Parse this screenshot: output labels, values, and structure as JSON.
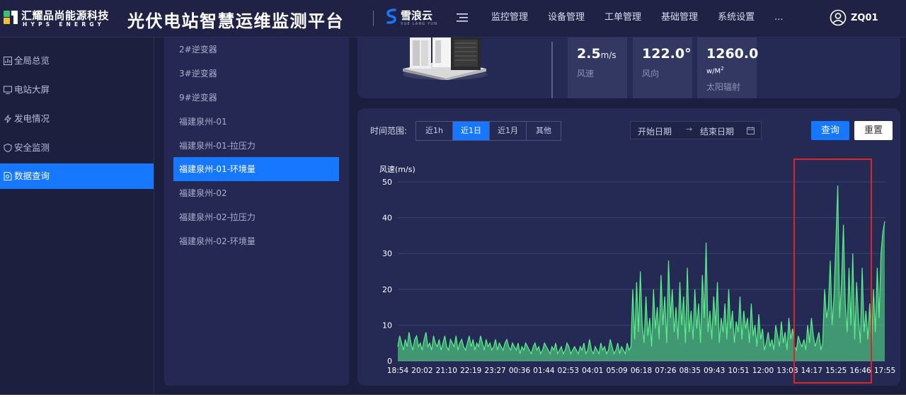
{
  "header": {
    "logo_text": "汇耀品尚能源科技",
    "logo_subtext": "HYPS ENERGY",
    "app_title": "光伏电站智慧运维监测平台",
    "brand_name": "雪浪云",
    "brand_subtext": "XUE LANG YUN",
    "nav": [
      "监控管理",
      "设备管理",
      "工单管理",
      "基础管理",
      "系统设置",
      "..."
    ],
    "user_name": "ZQ01"
  },
  "sidebar": {
    "items": [
      {
        "label": "全局总览",
        "icon": "dashboard-icon",
        "active": false
      },
      {
        "label": "电站大屏",
        "icon": "monitor-icon",
        "active": false
      },
      {
        "label": "发电情况",
        "icon": "lightning-icon",
        "active": false
      },
      {
        "label": "安全监测",
        "icon": "shield-icon",
        "active": false
      },
      {
        "label": "数据查询",
        "icon": "document-search-icon",
        "active": true
      }
    ]
  },
  "device_list": {
    "items": [
      {
        "label": "2#逆变器",
        "active": false
      },
      {
        "label": "3#逆变器",
        "active": false
      },
      {
        "label": "9#逆变器",
        "active": false
      },
      {
        "label": "福建泉州-01",
        "active": false
      },
      {
        "label": "福建泉州-01-拉压力",
        "active": false
      },
      {
        "label": "福建泉州-01-环境量",
        "active": true
      },
      {
        "label": "福建泉州-02",
        "active": false
      },
      {
        "label": "福建泉州-02-拉压力",
        "active": false
      },
      {
        "label": "福建泉州-02-环境量",
        "active": false
      }
    ]
  },
  "metrics": [
    {
      "value": "2.5",
      "unit": "m/s",
      "label": "风速"
    },
    {
      "value": "122.0°",
      "unit": "",
      "label": "风向"
    },
    {
      "value": "1260.0",
      "unit": "w/M",
      "unit_sup": "2",
      "label": "太阳辐射"
    }
  ],
  "filters": {
    "range_label": "时间范围:",
    "ranges": [
      {
        "label": "近1h",
        "active": false
      },
      {
        "label": "近1日",
        "active": true
      },
      {
        "label": "近1月",
        "active": false
      },
      {
        "label": "其他",
        "active": false
      }
    ],
    "start_placeholder": "开始日期",
    "end_placeholder": "结束日期",
    "query_label": "查询",
    "reset_label": "重置"
  },
  "colors": {
    "accent": "#1677ff",
    "series": "#59f08a",
    "highlight": "#e02424",
    "panel": "#252a55",
    "background": "#1b1e3c"
  },
  "chart_data": {
    "type": "line",
    "title": "",
    "xlabel": "",
    "ylabel": "风速(m/s)",
    "ylim": [
      0,
      50
    ],
    "yticks": [
      0,
      10,
      20,
      30,
      40,
      50
    ],
    "grid": true,
    "legend": "none",
    "x_tick_labels": [
      "18:54",
      "20:02",
      "21:10",
      "22:19",
      "23:27",
      "00:36",
      "01:44",
      "02:53",
      "04:01",
      "05:09",
      "06:18",
      "07:26",
      "08:35",
      "09:43",
      "10:51",
      "12:00",
      "13:08",
      "14:17",
      "15:25",
      "16:46",
      "17:55"
    ],
    "series": [
      {
        "values": [
          4,
          7,
          5,
          3,
          6,
          4,
          8,
          5,
          3,
          6,
          7,
          4,
          5,
          3,
          6,
          8,
          4,
          5,
          3,
          7,
          5,
          4,
          6,
          3,
          5,
          7,
          4,
          3,
          6,
          5,
          4,
          7,
          3,
          5,
          6,
          4,
          3,
          5,
          7,
          4,
          6,
          3,
          5,
          4,
          7,
          5,
          3,
          6,
          4,
          5,
          3,
          4,
          6,
          3,
          5,
          4,
          3,
          5,
          6,
          4,
          3,
          5,
          4,
          3,
          5,
          2,
          4,
          3,
          5,
          4,
          3,
          2,
          4,
          5,
          3,
          4,
          2,
          3,
          5,
          4,
          3,
          2,
          4,
          3,
          5,
          2,
          3,
          4,
          2,
          3,
          5,
          4,
          2,
          3,
          4,
          3,
          2,
          4,
          3,
          5,
          2,
          3,
          6,
          3,
          2,
          4,
          3,
          2,
          5,
          3,
          4,
          2,
          3,
          6,
          4,
          2,
          3,
          5,
          2,
          4,
          3,
          2,
          5,
          3,
          4,
          20,
          6,
          22,
          8,
          25,
          10,
          5,
          18,
          7,
          12,
          4,
          20,
          9,
          15,
          6,
          24,
          10,
          18,
          5,
          28,
          12,
          20,
          8,
          15,
          6,
          22,
          10,
          18,
          5,
          26,
          8,
          14,
          6,
          20,
          9,
          16,
          5,
          24,
          12,
          33,
          8,
          14,
          6,
          18,
          10,
          22,
          5,
          12,
          8,
          16,
          6,
          20,
          9,
          14,
          5,
          11,
          8,
          18,
          6,
          14,
          9,
          12,
          5,
          16,
          7,
          10,
          4,
          13,
          6,
          9,
          3,
          5,
          8,
          4,
          6,
          3,
          10,
          7,
          4,
          11,
          5,
          8,
          3,
          12,
          6,
          9,
          4,
          3,
          7,
          5,
          4,
          6,
          3,
          10,
          5,
          12,
          7,
          4,
          6,
          8,
          3,
          5,
          20,
          12,
          15,
          28,
          10,
          18,
          33,
          49,
          12,
          22,
          38,
          16,
          8,
          26,
          10,
          30,
          6,
          22,
          12,
          5,
          26,
          8,
          14,
          6,
          16,
          4,
          20,
          8,
          26,
          12,
          30,
          36,
          39
        ]
      }
    ]
  }
}
